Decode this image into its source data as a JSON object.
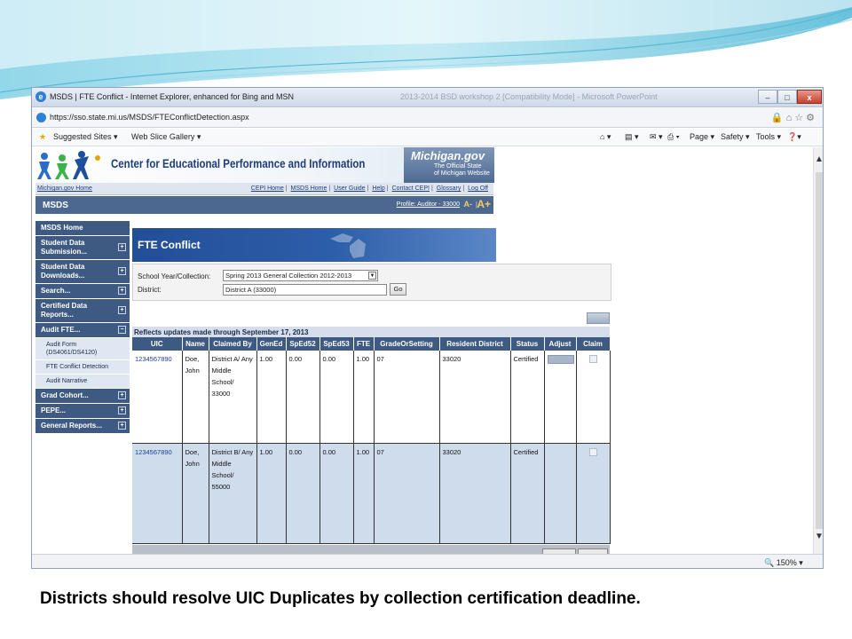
{
  "window": {
    "title": "MSDS | FTE Conflict - Internet Explorer, enhanced for Bing and MSN",
    "background_title": "2013-2014 BSD workshop 2 [Compatibility Mode] - Microsoft PowerPoint",
    "min": "–",
    "max": "□",
    "close": "x"
  },
  "address": {
    "url": "https://sso.state.mi.us/MSDS/FTEConflictDetection.aspx"
  },
  "favorites": {
    "suggested": "Suggested Sites ▾",
    "webslice": "Web Slice Gallery ▾",
    "page": "Page ▾",
    "safety": "Safety ▾",
    "tools": "Tools ▾"
  },
  "status_bar": {
    "zoom": "150%"
  },
  "header": {
    "title": "Center for Educational Performance and Information",
    "michigan_brand": "Michigan.gov",
    "michigan_tagline_1": "The Official State",
    "michigan_tagline_2": "of Michigan Website"
  },
  "top_nav": {
    "home_link": "Michigan.gov Home",
    "links": [
      "CEPI Home",
      "MSDS Home",
      "User Guide",
      "Help",
      "Contact CEPI",
      "Glossary",
      "Log Off"
    ]
  },
  "msds_bar": {
    "brand": "MSDS",
    "profile": "Profile: Auditor - 33000",
    "text_smaller": "A-",
    "separator": "|",
    "text_larger": "A+"
  },
  "sidebar": {
    "items": [
      {
        "label": "MSDS Home",
        "expand": ""
      },
      {
        "label": "Student Data Submission...",
        "expand": "+"
      },
      {
        "label": "Student Data Downloads...",
        "expand": "+"
      },
      {
        "label": "Search...",
        "expand": "+"
      },
      {
        "label": "Certified Data Reports...",
        "expand": "+"
      },
      {
        "label": "Audit FTE...",
        "expand": "−"
      },
      {
        "label": "Grad Cohort...",
        "expand": "+"
      },
      {
        "label": "PEPE...",
        "expand": "+"
      },
      {
        "label": "General Reports...",
        "expand": "+"
      }
    ],
    "audit_subitems": [
      "Audit Form (DS4061/DS4120)",
      "FTE Conflict Detection",
      "Audit Narrative"
    ]
  },
  "main": {
    "page_title": "FTE Conflict",
    "school_year_label": "School Year/Collection:",
    "school_year_value": "Spring 2013 General Collection 2012-2013",
    "district_label": "District:",
    "district_value": "District A (33000)",
    "go_label": "Go",
    "updates_text": "Reflects updates made through September 17, 2013"
  },
  "table": {
    "headers": [
      "UIC",
      "Name",
      "Claimed By",
      "GenEd",
      "SpEd52",
      "SpEd53",
      "FTE",
      "GradeOrSetting",
      "Resident District",
      "Status",
      "Adjust",
      "Claim"
    ],
    "rows": [
      {
        "uic": "1234567890",
        "name": "Doe, John",
        "claimed_by": "District A/ Any Middle School/ 33000",
        "gened": "1.00",
        "sped52": "0.00",
        "sped53": "0.00",
        "fte": "1.00",
        "grade": "07",
        "resident": "33020",
        "status": "Certified"
      },
      {
        "uic": "1234567890",
        "name": "Doe, John",
        "claimed_by": "District B/ Any Middle School/ 55000",
        "gened": "1.00",
        "sped52": "0.00",
        "sped53": "0.00",
        "fte": "1.00",
        "grade": "07",
        "resident": "33020",
        "status": "Certified"
      }
    ]
  },
  "caption": "Districts should resolve UIC Duplicates by collection certification deadline."
}
